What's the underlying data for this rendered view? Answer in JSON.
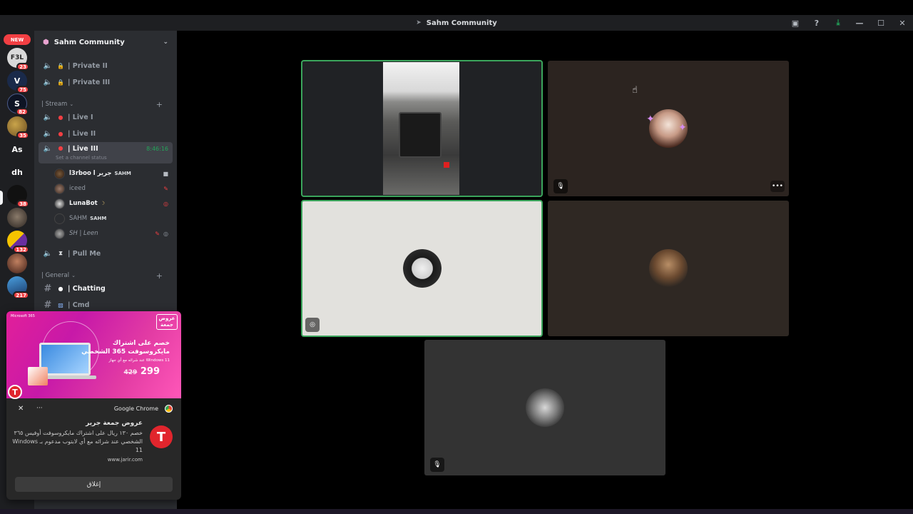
{
  "window": {
    "title": "Sahm Community"
  },
  "rail": {
    "new_label": "NEW",
    "servers": [
      {
        "label": "F3L",
        "badge": "23"
      },
      {
        "label": "V",
        "badge": "75"
      },
      {
        "label": "S",
        "badge": "82"
      },
      {
        "label": "",
        "badge": "35"
      },
      {
        "label": "As",
        "badge": ""
      },
      {
        "label": "dh",
        "badge": ""
      },
      {
        "label": "",
        "badge": "38"
      },
      {
        "label": "",
        "badge": ""
      },
      {
        "label": "",
        "badge": "132"
      },
      {
        "label": "",
        "badge": ""
      },
      {
        "label": "",
        "badge": "217"
      }
    ]
  },
  "guild": {
    "name": "Sahm Community"
  },
  "channels": {
    "private_2": "| Private II",
    "private_3": "| Private III",
    "stream_category": "| Stream",
    "live_1": "| Live I",
    "live_2": "| Live II",
    "live_3": "| Live III",
    "live_3_timer": "8:46:16",
    "live_3_status": "Set a channel status",
    "voice_users": [
      {
        "name": "l3rboo l جرير",
        "tag": "SAHM"
      },
      {
        "name": "iceed",
        "tag": ""
      },
      {
        "name": "LunaBot",
        "tag": ""
      },
      {
        "name": "SAHM",
        "tag": "SAHM"
      },
      {
        "name": "SH | Leen",
        "tag": ""
      }
    ],
    "pull_me": "| Pull Me",
    "general_category": "| General",
    "chatting": "| Chatting",
    "cmd": "| Cmd"
  },
  "notification": {
    "app": "Google Chrome",
    "ad_badge_line1": "عروض",
    "ad_badge_line2": "جمعة",
    "ad_headline1": "خصم على اشتراك",
    "ad_headline2": "مايكروسوفت 365 الشخصي",
    "ad_subline": "عند شرائه مع أي جهاز Windows 11",
    "ad_price_new": "299",
    "ad_price_old": "429",
    "ad_brand": "Microsoft 365",
    "title": "عروض جمعة جرير",
    "body": "خصم ١٣٠ ريال على اشتراك مايكروسوفت أوفيس ٣٦٥ الشخصي عند شرائه مع أي لابتوب مدعوم بـ Windows 11",
    "source": "www.jarir.com",
    "close_button": "إغلاق"
  },
  "colors": {
    "speaking_outline": "#3ba55c",
    "sidebar_bg": "#2b2d31",
    "rail_bg": "#1e1f22",
    "badge_red": "#f23f43",
    "ad_magenta": "#e21f9a"
  }
}
